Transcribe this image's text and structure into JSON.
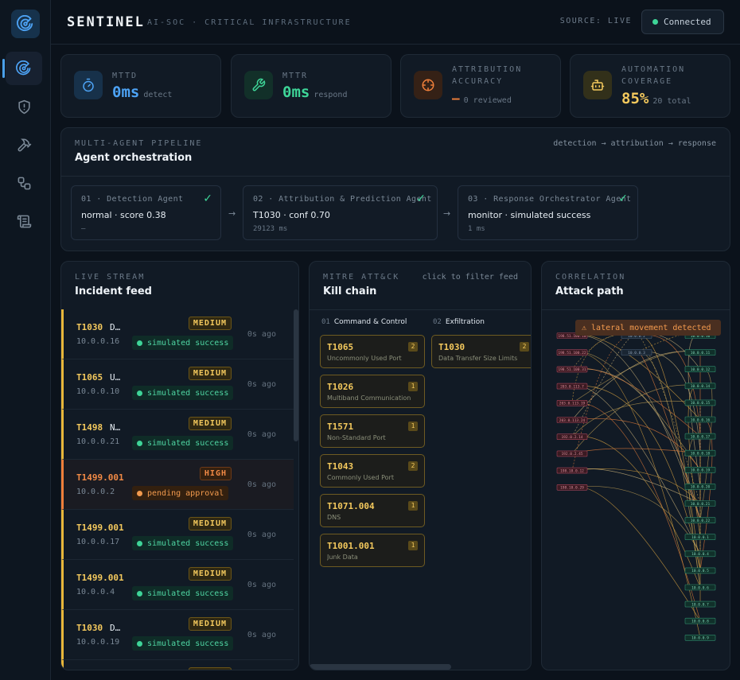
{
  "app": {
    "brand": "SENTINEL",
    "subtitle": "AI-SOC · CRITICAL INFRASTRUCTURE",
    "source_label": "SOURCE: LIVE",
    "connection": "Connected"
  },
  "sidebar": {
    "items": [
      {
        "name": "radar-icon",
        "active": true
      },
      {
        "name": "shield-alert-icon",
        "active": false
      },
      {
        "name": "hammer-icon",
        "active": false
      },
      {
        "name": "workflow-icon",
        "active": false
      },
      {
        "name": "scroll-icon",
        "active": false
      }
    ]
  },
  "kpis": [
    {
      "label": "MTTD",
      "value": "0ms",
      "sub": "detect",
      "icon": "timer-icon",
      "color": "#4da3f5"
    },
    {
      "label": "MTTR",
      "value": "0ms",
      "sub": "respond",
      "icon": "wrench-icon",
      "color": "#3ed598"
    },
    {
      "label": "ATTRIBUTION ACCURACY",
      "value": "—",
      "sub": "0 reviewed",
      "icon": "crosshair-icon",
      "color": "#ef7f3a"
    },
    {
      "label": "AUTOMATION COVERAGE",
      "value": "85%",
      "sub": "20 total",
      "icon": "bot-icon",
      "color": "#f4c95d"
    }
  ],
  "pipeline": {
    "label": "MULTI-AGENT PIPELINE",
    "title": "Agent orchestration",
    "flow": "detection → attribution → response",
    "agents": [
      {
        "head": "01 · Detection Agent",
        "status": "normal · score 0.38",
        "meta": "—"
      },
      {
        "head": "02 · Attribution & Prediction Agent",
        "status": "T1030 · conf 0.70",
        "meta": "29123 ms"
      },
      {
        "head": "03 · Response Orchestrator Agent",
        "status": "monitor · simulated success",
        "meta": "1 ms"
      }
    ],
    "arrow": "→",
    "check": "✓"
  },
  "feed": {
    "label": "LIVE STREAM",
    "title": "Incident feed",
    "rows": [
      {
        "tech": "T1030",
        "name": "D…",
        "ip": "10.0.0.16",
        "severity": "MEDIUM",
        "status": "simulated success",
        "ago": "0s ago",
        "level": "medium",
        "state": "ok"
      },
      {
        "tech": "T1065",
        "name": "U…",
        "ip": "10.0.0.10",
        "severity": "MEDIUM",
        "status": "simulated success",
        "ago": "0s ago",
        "level": "medium",
        "state": "ok"
      },
      {
        "tech": "T1498",
        "name": "N…",
        "ip": "10.0.0.21",
        "severity": "MEDIUM",
        "status": "simulated success",
        "ago": "0s ago",
        "level": "medium",
        "state": "ok"
      },
      {
        "tech": "T1499.001",
        "name": "",
        "ip": "10.0.0.2",
        "severity": "HIGH",
        "status": "pending approval",
        "ago": "0s ago",
        "level": "high",
        "state": "pending"
      },
      {
        "tech": "T1499.001",
        "name": "",
        "ip": "10.0.0.17",
        "severity": "MEDIUM",
        "status": "simulated success",
        "ago": "0s ago",
        "level": "medium",
        "state": "ok"
      },
      {
        "tech": "T1499.001",
        "name": "",
        "ip": "10.0.0.4",
        "severity": "MEDIUM",
        "status": "simulated success",
        "ago": "0s ago",
        "level": "medium",
        "state": "ok"
      },
      {
        "tech": "T1030",
        "name": "D…",
        "ip": "10.0.0.19",
        "severity": "MEDIUM",
        "status": "simulated success",
        "ago": "0s ago",
        "level": "medium",
        "state": "ok"
      },
      {
        "tech": "",
        "name": "",
        "ip": "",
        "severity": "MEDIUM",
        "status": "",
        "ago": "",
        "level": "medium",
        "state": "ok"
      }
    ]
  },
  "killchain": {
    "label": "MITRE ATT&CK",
    "hint": "click to filter feed",
    "title": "Kill chain",
    "tactics": [
      {
        "num": "01",
        "name": "Command & Control",
        "techniques": [
          {
            "id": "T1065",
            "name": "Uncommonly Used Port",
            "count": "2"
          },
          {
            "id": "T1026",
            "name": "Multiband Communication",
            "count": "1"
          },
          {
            "id": "T1571",
            "name": "Non-Standard Port",
            "count": "1"
          },
          {
            "id": "T1043",
            "name": "Commonly Used Port",
            "count": "2"
          },
          {
            "id": "T1071.004",
            "name": "DNS",
            "count": "1"
          },
          {
            "id": "T1001.001",
            "name": "Junk Data",
            "count": "1"
          }
        ]
      },
      {
        "num": "02",
        "name": "Exfiltration",
        "techniques": [
          {
            "id": "T1030",
            "name": "Data Transfer Size Limits",
            "count": "2"
          }
        ]
      }
    ]
  },
  "attack_path": {
    "label": "CORRELATION",
    "title": "Attack path",
    "alert": "lateral movement detected",
    "alert_icon": "warning-icon",
    "sources": [
      "198.51.100.10",
      "198.51.100.22",
      "198.51.100.31",
      "203.0.113.7",
      "203.0.113.19",
      "203.0.113.24",
      "192.0.2.14",
      "192.0.2.45",
      "198.18.0.12",
      "198.18.0.29"
    ],
    "mids": [
      "10.0.0.2",
      "10.0.0.3"
    ],
    "targets": [
      "10.0.0.10",
      "10.0.0.11",
      "10.0.0.12",
      "10.0.0.14",
      "10.0.0.15",
      "10.0.0.16",
      "10.0.0.17",
      "10.0.0.18",
      "10.0.0.19",
      "10.0.0.20",
      "10.0.0.21",
      "10.0.0.22",
      "10.0.0.1",
      "10.0.0.4",
      "10.0.0.5",
      "10.0.0.6",
      "10.0.0.7",
      "10.0.0.8",
      "10.0.0.9"
    ]
  }
}
